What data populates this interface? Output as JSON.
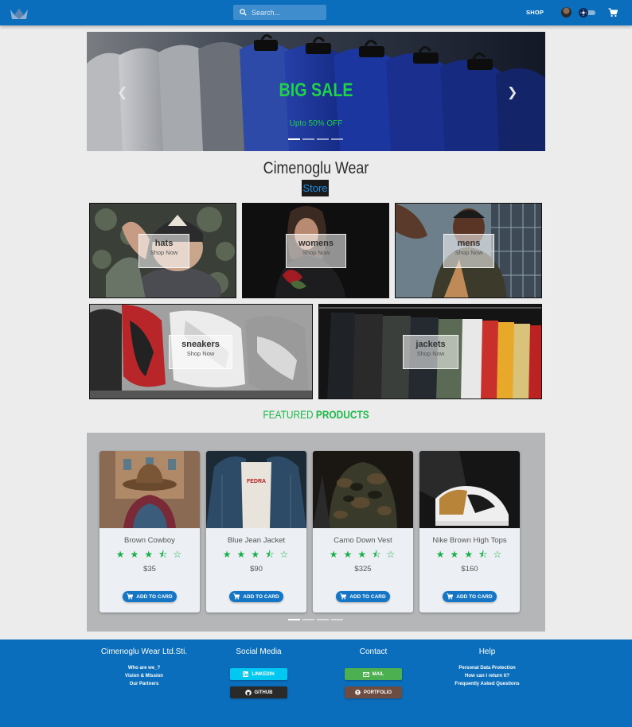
{
  "nav": {
    "search_placeholder": "Search...",
    "shop_label": "SHOP",
    "accent": "#0a6ebd"
  },
  "hero": {
    "title": "BIG SALE",
    "subtitle": "Upto 50% OFF",
    "prev_icon": "chevron-left-icon",
    "next_icon": "chevron-right-icon",
    "slides": 4,
    "active_slide": 1
  },
  "brand": {
    "name": "Cimenoglu Wear",
    "badge": "Store"
  },
  "categories": [
    {
      "name": "hats",
      "cta": "Shop Now"
    },
    {
      "name": "womens",
      "cta": "Shop Now"
    },
    {
      "name": "mens",
      "cta": "Shop Now"
    },
    {
      "name": "sneakers",
      "cta": "Shop Now"
    },
    {
      "name": "jackets",
      "cta": "Shop Now"
    }
  ],
  "featured": {
    "prefix": "FEATURED",
    "bold": "PRODUCTS"
  },
  "products": [
    {
      "name": "Brown Cowboy",
      "price": "$35",
      "rating": 3.5,
      "button": "ADD TO CARD"
    },
    {
      "name": "Blue Jean Jacket",
      "price": "$90",
      "rating": 3.5,
      "button": "ADD TO CARD"
    },
    {
      "name": "Camo Down Vest",
      "price": "$325",
      "rating": 3.5,
      "button": "ADD TO CARD"
    },
    {
      "name": "Nike Brown High Tops",
      "price": "$160",
      "rating": 3.5,
      "button": "ADD TO CARD"
    }
  ],
  "product_slides": {
    "count": 4,
    "active": 1
  },
  "footer": {
    "company": {
      "title": "Cimenoglu Wear Ltd.Sti.",
      "links": [
        "Who are we_?",
        "Vision & Mission",
        "Our Partners"
      ]
    },
    "social": {
      "title": "Social Media",
      "linkedin": "LINKEDIN",
      "github": "GITHUB",
      "linkedin_color": "#00c8f0",
      "github_color": "#2a2a2a"
    },
    "contact": {
      "title": "Contact",
      "mail": "MAIL",
      "portfolio": "PORTFOLIO",
      "mail_color": "#4caf50",
      "portfolio_color": "#6d4c41"
    },
    "help": {
      "title": "Help",
      "links": [
        "Personal Data Protection",
        "How can I return it?",
        "Frequently Asked Questions"
      ]
    }
  }
}
